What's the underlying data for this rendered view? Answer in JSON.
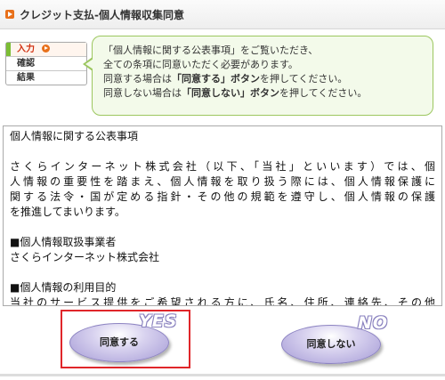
{
  "header": {
    "title": "クレジット支払-個人情報収集同意",
    "icon": "orange-arrow-icon"
  },
  "steps": [
    {
      "label": "入力",
      "state": "current"
    },
    {
      "label": "確認",
      "state": "pending"
    },
    {
      "label": "結果",
      "state": "pending"
    }
  ],
  "notice": {
    "line1": "「個人情報に関する公表事項」をご覧いただき、",
    "line2": "全ての条項に同意いただく必要があります。",
    "line3_pre": "同意する場合は",
    "line3_bold": "「同意する」ボタン",
    "line3_post": "を押してください。",
    "line4_pre": "同意しない場合は",
    "line4_bold": "「同意しない」ボタン",
    "line4_post": "を押してください。"
  },
  "privacy": {
    "title": "個人情報に関する公表事項",
    "para1_l1": "さくらインターネット株式会社（以下、「当社」といいます）では、個",
    "para1_l2": "人情報の重要性を踏まえ、個人情報を取り扱う際には、個人情報保護に",
    "para1_l3": "関する法令・国が定める指針・その他の規範を遵守し、個人情報の保護",
    "para1_l4": "を推進してまいります。",
    "sec1_heading": "■個人情報取扱事業者",
    "sec1_body": "さくらインターネット株式会社",
    "sec2_heading": "■個人情報の利用目的",
    "sec2_body": "当社のサービス提供をご希望される方に、氏名、住所、連絡先、その他"
  },
  "buttons": {
    "agree_label": "同意する",
    "agree_badge": "YES",
    "disagree_label": "同意しない",
    "disagree_badge": "NO"
  },
  "colors": {
    "accent_orange": "#e8701a",
    "notice_border": "#9cc75f",
    "notice_bg": "#f3faea",
    "highlight_red": "#e0262a",
    "button_purple": "#a59bd6"
  }
}
